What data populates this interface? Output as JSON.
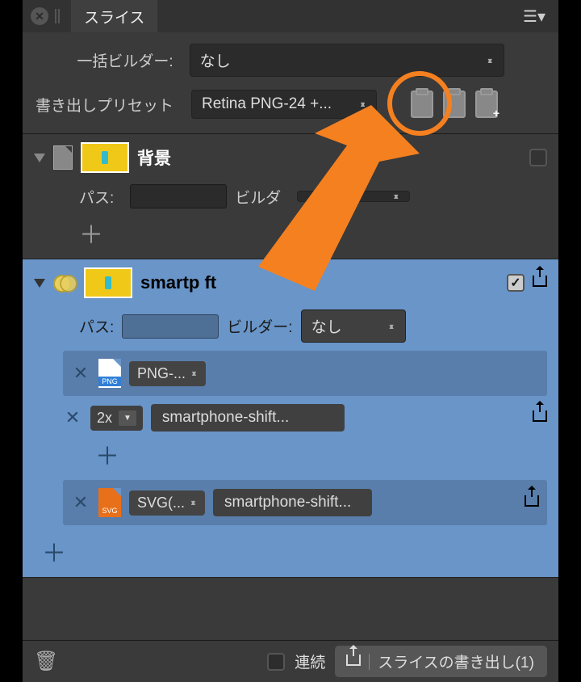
{
  "tab": {
    "title": "スライス"
  },
  "top": {
    "builder_label": "一括ビルダー:",
    "builder_value": "なし",
    "preset_label": "書き出しプリセット",
    "preset_value": "Retina PNG-24 +..."
  },
  "slices": [
    {
      "name": "背景",
      "path_label": "パス:",
      "builder_label": "ビルダ",
      "builder_value": ""
    },
    {
      "name": "smartp          ft",
      "path_label": "パス:",
      "builder_label": "ビルダー:",
      "builder_value": "なし",
      "exports": [
        {
          "format": "PNG-...",
          "sizes": [
            {
              "scale": "2x",
              "filename": "smartphone-shift..."
            }
          ]
        },
        {
          "format": "SVG(...",
          "filename": "smartphone-shift..."
        }
      ]
    }
  ],
  "footer": {
    "continuous": "連続",
    "export_button": "スライスの書き出し(1)"
  }
}
